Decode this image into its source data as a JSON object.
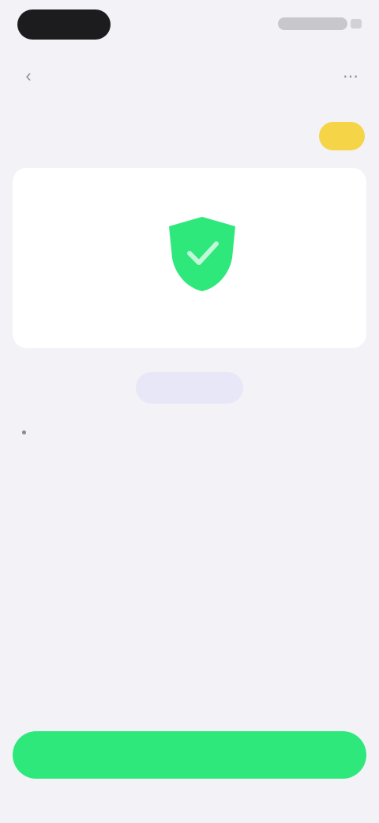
{
  "nav": {
    "back_icon": "chevron-left-icon",
    "title": "",
    "more_icon": "ellipsis-icon"
  },
  "header": {
    "title": "",
    "badge": ""
  },
  "card": {
    "shield_icon": "shield-icon",
    "shield_color": "#2ee87c",
    "caption": ""
  },
  "link_button": {
    "label": ""
  },
  "body": {
    "heading": "",
    "paragraph": "",
    "bullets": [
      "",
      "",
      ""
    ],
    "footer": ""
  },
  "primary_button": {
    "label": "",
    "color": "#2ee87c"
  },
  "colors": {
    "background": "#f2f2f7",
    "badge": "#f5d547",
    "link_button_bg": "#e7e7f7"
  }
}
